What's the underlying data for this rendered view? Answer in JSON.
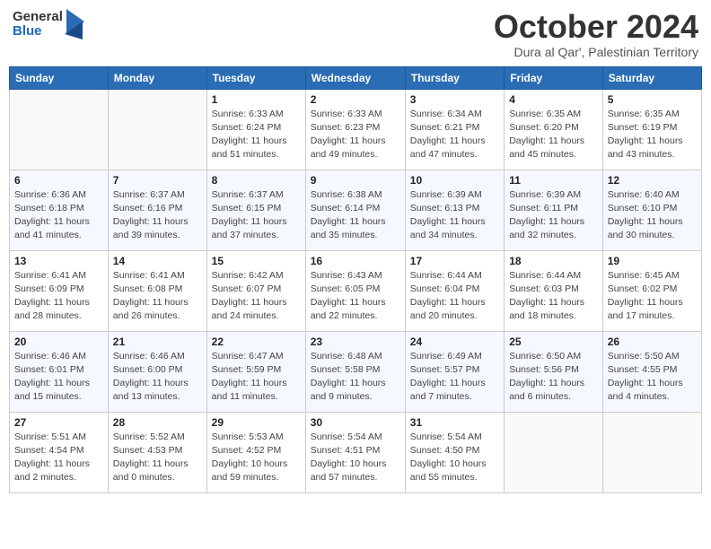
{
  "header": {
    "logo_general": "General",
    "logo_blue": "Blue",
    "month_title": "October 2024",
    "location": "Dura al Qar', Palestinian Territory"
  },
  "weekdays": [
    "Sunday",
    "Monday",
    "Tuesday",
    "Wednesday",
    "Thursday",
    "Friday",
    "Saturday"
  ],
  "weeks": [
    [
      {
        "day": "",
        "info": ""
      },
      {
        "day": "",
        "info": ""
      },
      {
        "day": "1",
        "info": "Sunrise: 6:33 AM\nSunset: 6:24 PM\nDaylight: 11 hours and 51 minutes."
      },
      {
        "day": "2",
        "info": "Sunrise: 6:33 AM\nSunset: 6:23 PM\nDaylight: 11 hours and 49 minutes."
      },
      {
        "day": "3",
        "info": "Sunrise: 6:34 AM\nSunset: 6:21 PM\nDaylight: 11 hours and 47 minutes."
      },
      {
        "day": "4",
        "info": "Sunrise: 6:35 AM\nSunset: 6:20 PM\nDaylight: 11 hours and 45 minutes."
      },
      {
        "day": "5",
        "info": "Sunrise: 6:35 AM\nSunset: 6:19 PM\nDaylight: 11 hours and 43 minutes."
      }
    ],
    [
      {
        "day": "6",
        "info": "Sunrise: 6:36 AM\nSunset: 6:18 PM\nDaylight: 11 hours and 41 minutes."
      },
      {
        "day": "7",
        "info": "Sunrise: 6:37 AM\nSunset: 6:16 PM\nDaylight: 11 hours and 39 minutes."
      },
      {
        "day": "8",
        "info": "Sunrise: 6:37 AM\nSunset: 6:15 PM\nDaylight: 11 hours and 37 minutes."
      },
      {
        "day": "9",
        "info": "Sunrise: 6:38 AM\nSunset: 6:14 PM\nDaylight: 11 hours and 35 minutes."
      },
      {
        "day": "10",
        "info": "Sunrise: 6:39 AM\nSunset: 6:13 PM\nDaylight: 11 hours and 34 minutes."
      },
      {
        "day": "11",
        "info": "Sunrise: 6:39 AM\nSunset: 6:11 PM\nDaylight: 11 hours and 32 minutes."
      },
      {
        "day": "12",
        "info": "Sunrise: 6:40 AM\nSunset: 6:10 PM\nDaylight: 11 hours and 30 minutes."
      }
    ],
    [
      {
        "day": "13",
        "info": "Sunrise: 6:41 AM\nSunset: 6:09 PM\nDaylight: 11 hours and 28 minutes."
      },
      {
        "day": "14",
        "info": "Sunrise: 6:41 AM\nSunset: 6:08 PM\nDaylight: 11 hours and 26 minutes."
      },
      {
        "day": "15",
        "info": "Sunrise: 6:42 AM\nSunset: 6:07 PM\nDaylight: 11 hours and 24 minutes."
      },
      {
        "day": "16",
        "info": "Sunrise: 6:43 AM\nSunset: 6:05 PM\nDaylight: 11 hours and 22 minutes."
      },
      {
        "day": "17",
        "info": "Sunrise: 6:44 AM\nSunset: 6:04 PM\nDaylight: 11 hours and 20 minutes."
      },
      {
        "day": "18",
        "info": "Sunrise: 6:44 AM\nSunset: 6:03 PM\nDaylight: 11 hours and 18 minutes."
      },
      {
        "day": "19",
        "info": "Sunrise: 6:45 AM\nSunset: 6:02 PM\nDaylight: 11 hours and 17 minutes."
      }
    ],
    [
      {
        "day": "20",
        "info": "Sunrise: 6:46 AM\nSunset: 6:01 PM\nDaylight: 11 hours and 15 minutes."
      },
      {
        "day": "21",
        "info": "Sunrise: 6:46 AM\nSunset: 6:00 PM\nDaylight: 11 hours and 13 minutes."
      },
      {
        "day": "22",
        "info": "Sunrise: 6:47 AM\nSunset: 5:59 PM\nDaylight: 11 hours and 11 minutes."
      },
      {
        "day": "23",
        "info": "Sunrise: 6:48 AM\nSunset: 5:58 PM\nDaylight: 11 hours and 9 minutes."
      },
      {
        "day": "24",
        "info": "Sunrise: 6:49 AM\nSunset: 5:57 PM\nDaylight: 11 hours and 7 minutes."
      },
      {
        "day": "25",
        "info": "Sunrise: 6:50 AM\nSunset: 5:56 PM\nDaylight: 11 hours and 6 minutes."
      },
      {
        "day": "26",
        "info": "Sunrise: 5:50 AM\nSunset: 4:55 PM\nDaylight: 11 hours and 4 minutes."
      }
    ],
    [
      {
        "day": "27",
        "info": "Sunrise: 5:51 AM\nSunset: 4:54 PM\nDaylight: 11 hours and 2 minutes."
      },
      {
        "day": "28",
        "info": "Sunrise: 5:52 AM\nSunset: 4:53 PM\nDaylight: 11 hours and 0 minutes."
      },
      {
        "day": "29",
        "info": "Sunrise: 5:53 AM\nSunset: 4:52 PM\nDaylight: 10 hours and 59 minutes."
      },
      {
        "day": "30",
        "info": "Sunrise: 5:54 AM\nSunset: 4:51 PM\nDaylight: 10 hours and 57 minutes."
      },
      {
        "day": "31",
        "info": "Sunrise: 5:54 AM\nSunset: 4:50 PM\nDaylight: 10 hours and 55 minutes."
      },
      {
        "day": "",
        "info": ""
      },
      {
        "day": "",
        "info": ""
      }
    ]
  ]
}
